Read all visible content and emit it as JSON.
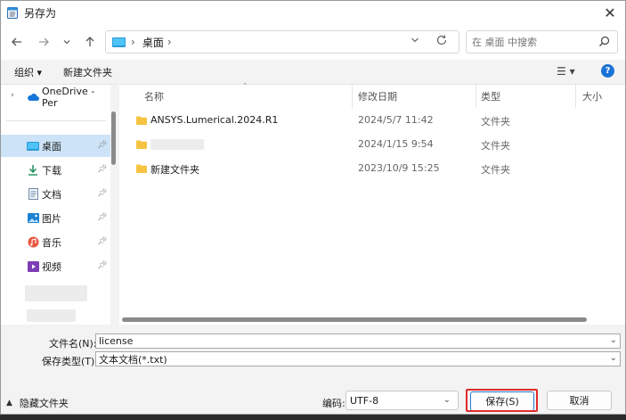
{
  "window": {
    "title": "另存为",
    "close_glyph": "✕"
  },
  "nav": {
    "back_icon": "arrow-left-icon",
    "forward_icon": "arrow-right-icon",
    "recent_icon": "chevron-down-icon",
    "up_icon": "arrow-up-icon",
    "address": {
      "location": "桌面",
      "separator": "›"
    },
    "search_placeholder": "在 桌面 中搜索"
  },
  "toolbar": {
    "organize_label": "组织 ▾",
    "new_folder_label": "新建文件夹",
    "view_glyph": "☰ ▾",
    "help_glyph": "?"
  },
  "sidebar": {
    "onedrive_label": "OneDrive - Per",
    "items": [
      {
        "label": "桌面",
        "icon": "desktop-icon",
        "selected": true
      },
      {
        "label": "下载",
        "icon": "download-icon"
      },
      {
        "label": "文档",
        "icon": "documents-icon"
      },
      {
        "label": "图片",
        "icon": "pictures-icon"
      },
      {
        "label": "音乐",
        "icon": "music-icon"
      },
      {
        "label": "视频",
        "icon": "videos-icon"
      }
    ]
  },
  "list": {
    "columns": {
      "name": "名称",
      "modified": "修改日期",
      "type": "类型",
      "size": "大小"
    },
    "rows": [
      {
        "name": "ANSYS.Lumerical.2024.R1",
        "modified": "2024/5/7 11:42",
        "type": "文件夹"
      },
      {
        "name": "",
        "modified": "2024/1/15 9:54",
        "type": "文件夹"
      },
      {
        "name": "新建文件夹",
        "modified": "2023/10/9 15:25",
        "type": "文件夹"
      }
    ]
  },
  "form": {
    "filename_label": "文件名(N):",
    "filename_value": "license",
    "filetype_label": "保存类型(T):",
    "filetype_value": "文本文档(*.txt)",
    "hide_folders_label": "隐藏文件夹",
    "encoding_label": "编码:",
    "encoding_value": "UTF-8",
    "save_label": "保存(S)",
    "cancel_label": "取消"
  },
  "colors": {
    "accent": "#1a73d6",
    "selection": "#cde3f7",
    "highlight_box": "#e02a2a",
    "folder": "#f6c342"
  }
}
